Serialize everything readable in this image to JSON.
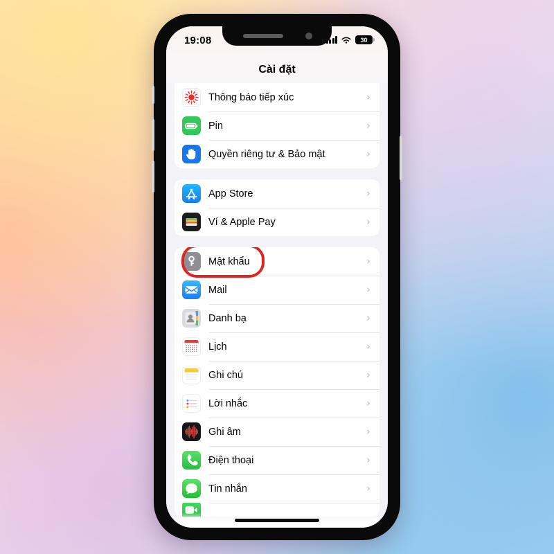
{
  "device": {
    "kind": "iphone-mockup",
    "frame_color": "#0a0a0a"
  },
  "status_bar": {
    "time": "19:08",
    "signal_icon": "cellular-bars-icon",
    "wifi_icon": "wifi-icon",
    "battery_icon": "battery-icon",
    "battery_level": "30"
  },
  "nav": {
    "title": "Cài đặt"
  },
  "annotation": {
    "type": "red-rounded-rect-highlight",
    "color": "#e02424",
    "targets_row": "Mật khẩu"
  },
  "groups": [
    {
      "id": "group-system",
      "rows": [
        {
          "label": "Thông báo tiếp xúc",
          "icon": "exposure-notifications-icon",
          "icon_class": "ico-exposure",
          "chevron": "›"
        },
        {
          "label": "Pin",
          "icon": "battery-icon",
          "icon_class": "ico-battery",
          "chevron": "›"
        },
        {
          "label": "Quyền riêng tư & Bảo mật",
          "icon": "privacy-hand-icon",
          "icon_class": "ico-privacy",
          "chevron": "›"
        }
      ]
    },
    {
      "id": "group-store",
      "rows": [
        {
          "label": "App Store",
          "icon": "app-store-icon",
          "icon_class": "ico-appstore",
          "chevron": "›"
        },
        {
          "label": "Ví & Apple Pay",
          "icon": "wallet-icon",
          "icon_class": "ico-wallet",
          "chevron": "›"
        }
      ]
    },
    {
      "id": "group-apps",
      "rows": [
        {
          "label": "Mật khẩu",
          "icon": "password-key-icon",
          "icon_class": "ico-password",
          "chevron": "›",
          "highlighted": true
        },
        {
          "label": "Mail",
          "icon": "mail-icon",
          "icon_class": "ico-mail",
          "chevron": "›"
        },
        {
          "label": "Danh bạ",
          "icon": "contacts-icon",
          "icon_class": "ico-contacts",
          "chevron": "›"
        },
        {
          "label": "Lịch",
          "icon": "calendar-icon",
          "icon_class": "ico-calendar",
          "chevron": "›"
        },
        {
          "label": "Ghi chú",
          "icon": "notes-icon",
          "icon_class": "ico-notes",
          "chevron": "›"
        },
        {
          "label": "Lời nhắc",
          "icon": "reminders-icon",
          "icon_class": "ico-reminders",
          "chevron": "›"
        },
        {
          "label": "Ghi âm",
          "icon": "voice-memos-icon",
          "icon_class": "ico-voice",
          "chevron": "›"
        },
        {
          "label": "Điện thoại",
          "icon": "phone-icon",
          "icon_class": "ico-phone",
          "chevron": "›"
        },
        {
          "label": "Tin nhắn",
          "icon": "messages-icon",
          "icon_class": "ico-messages",
          "chevron": "›"
        },
        {
          "label": "",
          "icon": "facetime-icon",
          "icon_class": "ico-facetime",
          "chevron": "",
          "clipped": true
        }
      ]
    }
  ]
}
